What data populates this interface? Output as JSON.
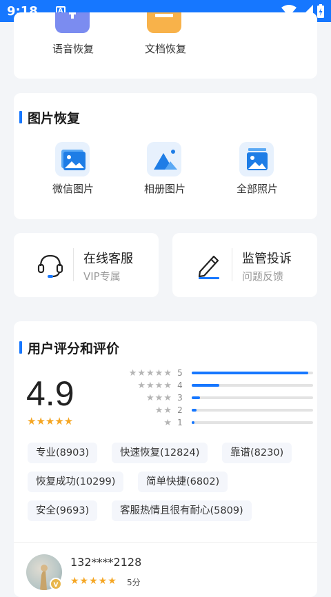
{
  "status": {
    "time": "9:18",
    "a_badge": "A"
  },
  "recovery_top": {
    "items": [
      {
        "label": "语音恢复",
        "icon": "microphone-icon"
      },
      {
        "label": "文档恢复",
        "icon": "document-icon"
      }
    ]
  },
  "image_recovery": {
    "title": "图片恢复",
    "items": [
      {
        "label": "微信图片",
        "icon": "picture-icon"
      },
      {
        "label": "相册图片",
        "icon": "album-icon"
      },
      {
        "label": "全部照片",
        "icon": "photos-icon"
      }
    ]
  },
  "services": [
    {
      "title": "在线客服",
      "subtitle": "VIP专属",
      "icon": "headset-icon"
    },
    {
      "title": "监管投诉",
      "subtitle": "问题反馈",
      "icon": "pen-icon"
    }
  ],
  "ratings": {
    "title": "用户评分和评价",
    "score": "4.9",
    "stars": "★★★★★",
    "colors": {
      "accent": "#1677ff",
      "star": "#f5a623"
    },
    "breakdown": [
      {
        "stars": "★★★★★",
        "label": "5",
        "fraction": 0.96
      },
      {
        "stars": "★★★★",
        "label": "4",
        "fraction": 0.23
      },
      {
        "stars": "★★★",
        "label": "3",
        "fraction": 0.07
      },
      {
        "stars": "★★",
        "label": "2",
        "fraction": 0.04
      },
      {
        "stars": "★",
        "label": "1",
        "fraction": 0.02
      }
    ],
    "tags": [
      "专业(8903)",
      "快速恢复(12824)",
      "靠谱(8230)",
      "恢复成功(10299)",
      "简单快捷(6802)",
      "安全(9693)",
      "客服热情且很有耐心(5809)"
    ]
  },
  "review": {
    "username": "132****2128",
    "stars": "★★★★★",
    "score_text": "5分",
    "badge": "V"
  }
}
